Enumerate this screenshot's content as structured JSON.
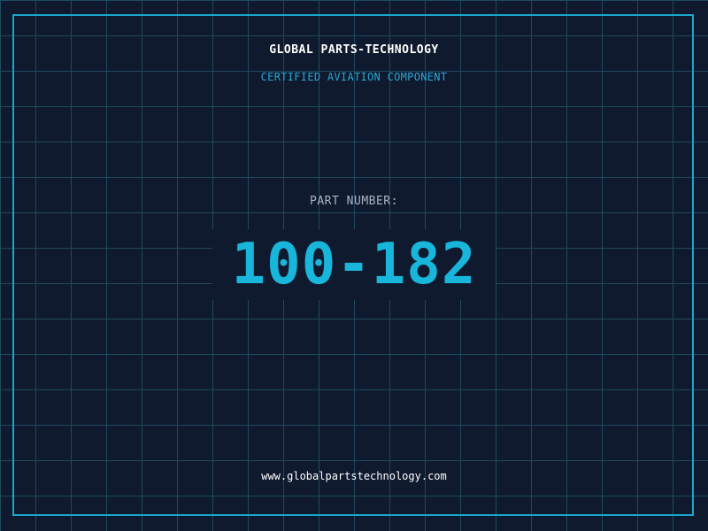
{
  "label": {
    "company": "GLOBAL PARTS-TECHNOLOGY",
    "subtitle": "CERTIFIED AVIATION COMPONENT",
    "part_label": "PART NUMBER:",
    "part_number": "100-182",
    "website": "www.globalpartstechnology.com"
  },
  "colors": {
    "background": "#101a2e",
    "grid": "#1f4a5e",
    "frame": "#1aa6cc",
    "accent": "#19b6dc",
    "subtitle": "#2aa7d4"
  }
}
